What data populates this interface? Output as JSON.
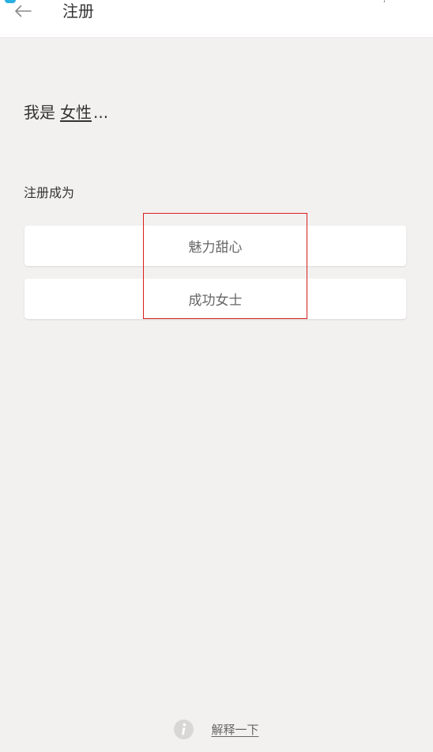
{
  "header": {
    "title": "注册",
    "back_icon": "arrow-left-icon",
    "status_mark": ","
  },
  "intro": {
    "prefix": "我是",
    "gender": "女性",
    "suffix": "..."
  },
  "register": {
    "label": "注册成为",
    "options": [
      {
        "label": "魅力甜心"
      },
      {
        "label": "成功女士"
      }
    ]
  },
  "footer": {
    "info_icon": "info-icon",
    "link": "解释一下"
  },
  "colors": {
    "background": "#f3f1f0",
    "card": "#ffffff",
    "highlight": "#d81e1e",
    "badge": "#2ab0e0"
  }
}
